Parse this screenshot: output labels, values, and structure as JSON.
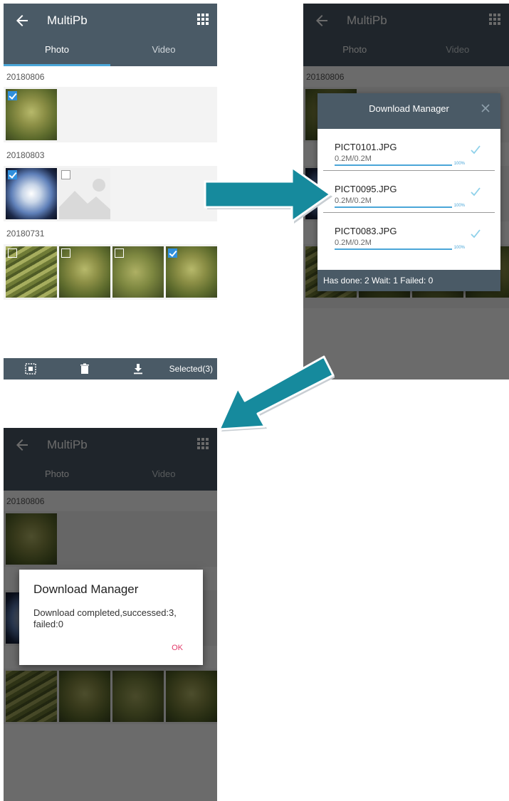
{
  "app": {
    "title": "MultiPb",
    "tabs": [
      "Photo",
      "Video"
    ]
  },
  "phone1": {
    "groups": [
      {
        "date": "20180806"
      },
      {
        "date": "20180803"
      },
      {
        "date": "20180731"
      }
    ],
    "bottombar": {
      "selected_label": "Selected(3)"
    }
  },
  "download_manager": {
    "title": "Download Manager",
    "items": [
      {
        "name": "PICT0101.JPG",
        "size": "0.2M/0.2M",
        "percent": "100%"
      },
      {
        "name": "PICT0095.JPG",
        "size": "0.2M/0.2M",
        "percent": "100%"
      },
      {
        "name": "PICT0083.JPG",
        "size": "0.2M/0.2M",
        "percent": "100%"
      }
    ],
    "status": "Has done: 2 Wait: 1 Failed: 0"
  },
  "complete_dialog": {
    "title": "Download Manager",
    "message": "Download completed,successed:3, failed:0",
    "ok_label": "OK"
  },
  "colors": {
    "appbar": "#4a5a66",
    "accent": "#4aa6d8",
    "arrow": "#168a9d",
    "ok": "#e23a6a"
  }
}
